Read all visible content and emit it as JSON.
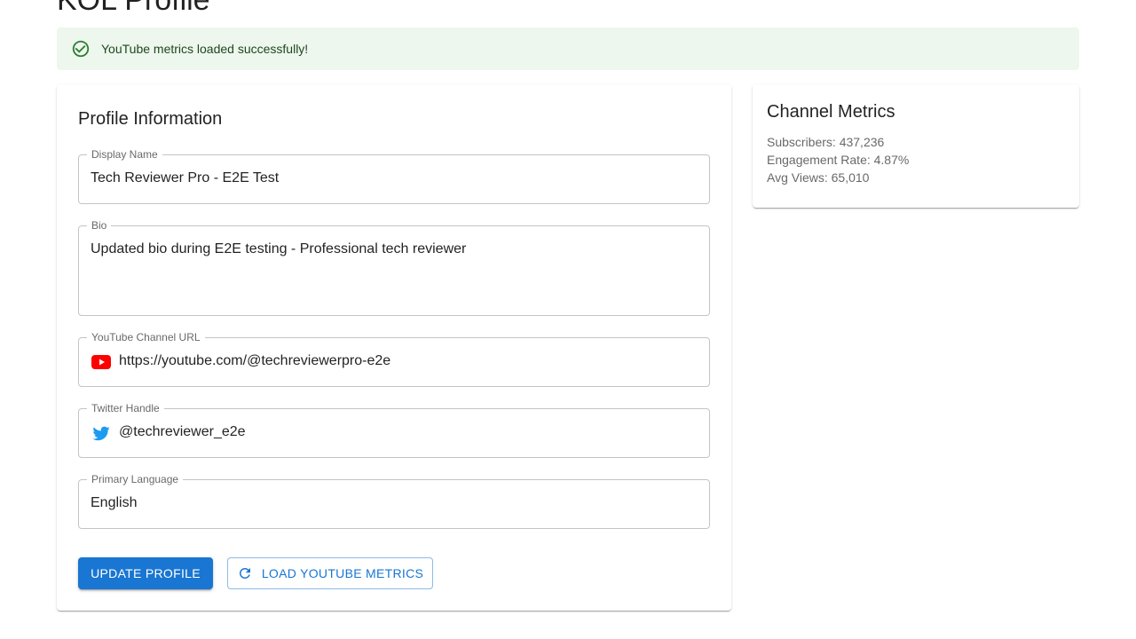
{
  "page": {
    "title": "KOL Profile"
  },
  "alert": {
    "message": "YouTube metrics loaded successfully!",
    "color": "#1e4620",
    "icon": "check-circle-icon"
  },
  "profile": {
    "title": "Profile Information",
    "fields": {
      "display_name": {
        "label": "Display Name",
        "value": "Tech Reviewer Pro - E2E Test"
      },
      "bio": {
        "label": "Bio",
        "value": "Updated bio during E2E testing - Professional tech reviewer"
      },
      "youtube_url": {
        "label": "YouTube Channel URL",
        "value": "https://youtube.com/@techreviewerpro-e2e",
        "icon": "youtube-icon"
      },
      "twitter": {
        "label": "Twitter Handle",
        "value": "@techreviewer_e2e",
        "icon": "twitter-icon"
      },
      "language": {
        "label": "Primary Language",
        "value": "English"
      }
    },
    "buttons": {
      "update": "UPDATE PROFILE",
      "load_metrics": "LOAD YOUTUBE METRICS"
    }
  },
  "metrics": {
    "title": "Channel Metrics",
    "subscribers": "Subscribers: 437,236",
    "engagement": "Engagement Rate: 4.87%",
    "avg_views": "Avg Views: 65,010"
  },
  "colors": {
    "primary": "#1976d2",
    "success_bg": "#edf7ed",
    "youtube": "#ff0000",
    "twitter": "#1d9bf0"
  }
}
